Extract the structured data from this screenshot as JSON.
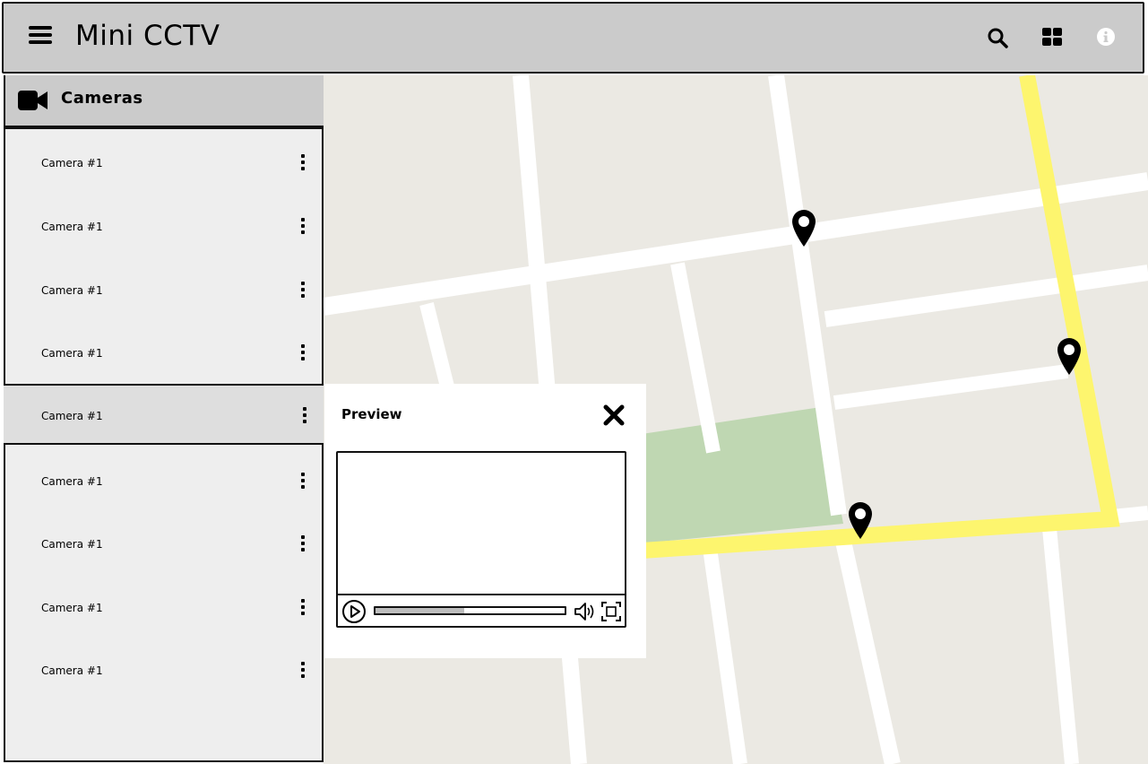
{
  "app": {
    "title": "Mini CCTV"
  },
  "header": {
    "icons": [
      "menu-icon",
      "search-icon",
      "grid-icon",
      "info-icon"
    ]
  },
  "sidebar": {
    "title": "Cameras",
    "icon": "video-camera-icon",
    "cameras": [
      {
        "label": "Camera #1"
      },
      {
        "label": "Camera #1"
      },
      {
        "label": "Camera #1"
      },
      {
        "label": "Camera #1"
      },
      {
        "label": "Camera #1"
      },
      {
        "label": "Camera #1"
      },
      {
        "label": "Camera #1"
      },
      {
        "label": "Camera #1"
      },
      {
        "label": "Camera #1"
      }
    ],
    "selected_index": 4
  },
  "preview": {
    "title": "Preview",
    "progress": 0.47
  },
  "map": {
    "markers_count": 3,
    "colors": {
      "land": "#ebe9e3",
      "road": "#ffffff",
      "highway": "#fdf56e",
      "park": "#bfd7b2"
    }
  }
}
